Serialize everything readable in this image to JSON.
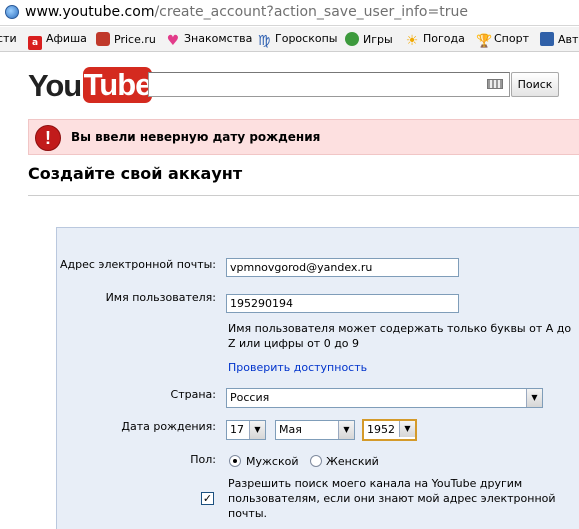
{
  "browser": {
    "url_host": "www.youtube.com",
    "url_path": "/create_account?action_save_user_info=true",
    "bookmarks": [
      {
        "label": "сти",
        "icon": "none",
        "color": "#f3f3f3"
      },
      {
        "label": "Афиша",
        "icon": "afisha-icon",
        "color": "#d81e1e"
      },
      {
        "label": "Price.ru",
        "icon": "gift-icon",
        "color": "#c0392b"
      },
      {
        "label": "Знакомства",
        "icon": "heart-icon",
        "color": "#e23b8a"
      },
      {
        "label": "Гороскопы",
        "icon": "zodiac-icon",
        "color": "#2a5db0"
      },
      {
        "label": "Игры",
        "icon": "games-icon",
        "color": "#3d9a3d"
      },
      {
        "label": "Погода",
        "icon": "sun-icon",
        "color": "#f2a900"
      },
      {
        "label": "Спорт",
        "icon": "trophy-icon",
        "color": "#d9a400"
      },
      {
        "label": "Авто",
        "icon": "car-icon",
        "color": "#3060a8"
      }
    ]
  },
  "header": {
    "logo_you": "You",
    "logo_tube": "Tube",
    "search_value": "",
    "search_button": "Поиск"
  },
  "error": {
    "icon": "!",
    "message": "Вы ввели неверную дату рождения"
  },
  "page": {
    "title": "Создайте свой аккаунт"
  },
  "form": {
    "email_label": "Адрес электронной почты:",
    "email_value": "vpmnovgorod@yandex.ru",
    "username_label": "Имя пользователя:",
    "username_value": "195290194",
    "username_hint": "Имя пользователя может содержать только буквы от A до Z или цифры от 0 до 9",
    "check_availability": "Проверить доступность",
    "country_label": "Страна:",
    "country_value": "Россия",
    "birthdate_label": "Дата рождения:",
    "birth_day": "17",
    "birth_month": "Мая",
    "birth_year": "1952",
    "gender_label": "Пол:",
    "gender_male": "Мужской",
    "gender_female": "Женский",
    "gender_selected": "male",
    "share_checked": true,
    "share_text": "Разрешить поиск моего канала на YouTube другим пользователям, если они знают мой адрес электронной почты."
  }
}
